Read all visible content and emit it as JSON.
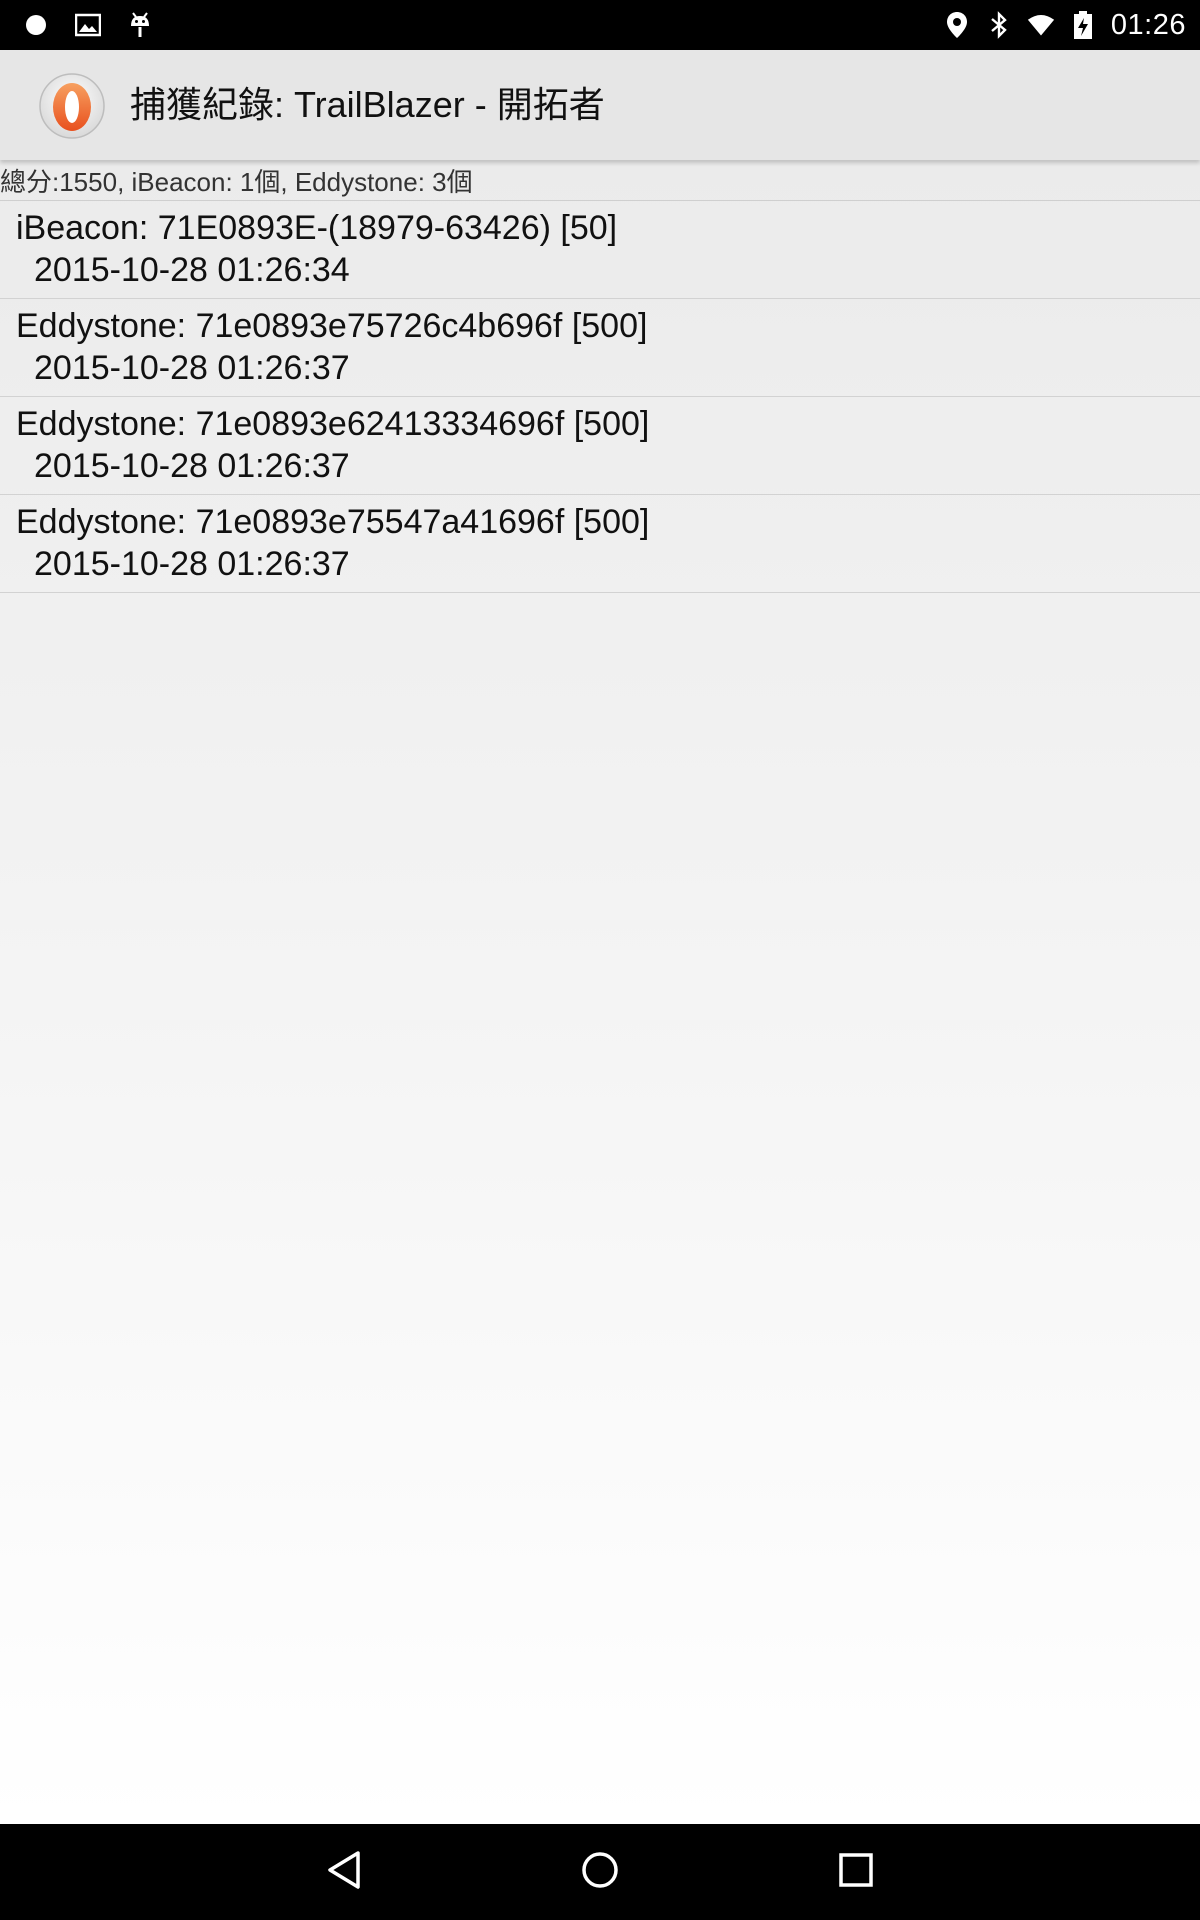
{
  "status_bar": {
    "left_icons": [
      "circle-icon",
      "image-icon",
      "android-icon"
    ],
    "right_icons": [
      "location-icon",
      "bluetooth-icon",
      "wifi-icon",
      "battery-charging-icon"
    ],
    "time": "01:26"
  },
  "action_bar": {
    "title": "捕獲紀錄: TrailBlazer - 開拓者",
    "logo_icon": "app-logo-icon",
    "background": "#e6e6e6"
  },
  "summary": "總分:1550, iBeacon: 1個, Eddystone: 3個",
  "records": [
    {
      "line1": "iBeacon: 71E0893E-(18979-63426) [50]",
      "line2": "2015-10-28 01:26:34"
    },
    {
      "line1": "Eddystone: 71e0893e75726c4b696f [500]",
      "line2": "2015-10-28 01:26:37"
    },
    {
      "line1": "Eddystone: 71e0893e62413334696f [500]",
      "line2": "2015-10-28 01:26:37"
    },
    {
      "line1": "Eddystone: 71e0893e75547a41696f [500]",
      "line2": "2015-10-28 01:26:37"
    }
  ],
  "nav_bar": {
    "buttons": [
      "back-icon",
      "home-icon",
      "recents-icon"
    ]
  },
  "colors": {
    "logo_orange": "#f07030",
    "status_bar": "#000000",
    "nav_bar": "#000000"
  }
}
